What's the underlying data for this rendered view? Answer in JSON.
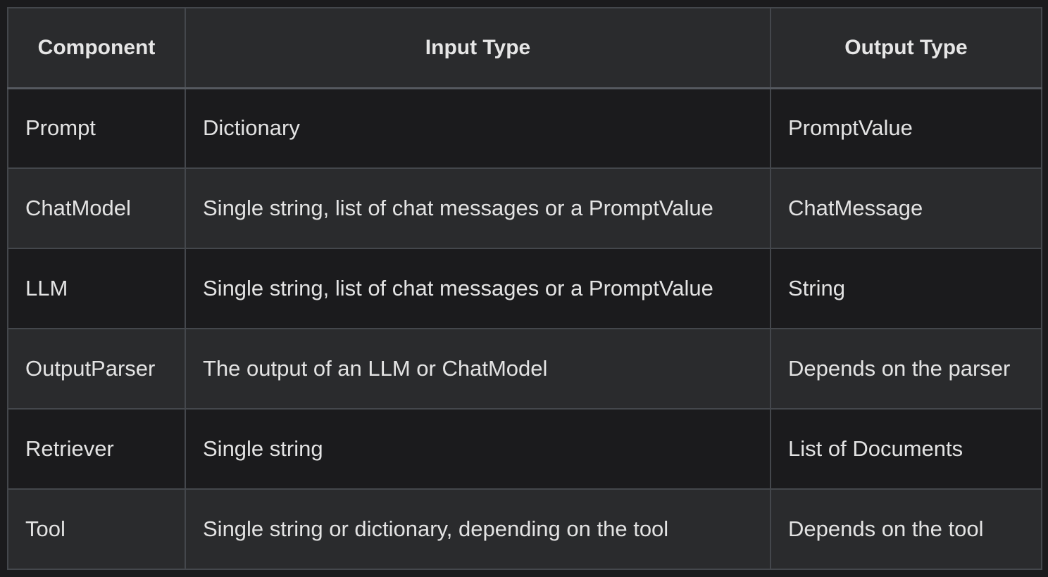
{
  "table": {
    "headers": [
      "Component",
      "Input Type",
      "Output Type"
    ],
    "rows": [
      [
        "Prompt",
        "Dictionary",
        "PromptValue"
      ],
      [
        "ChatModel",
        "Single string, list of chat messages or a PromptValue",
        "ChatMessage"
      ],
      [
        "LLM",
        "Single string, list of chat messages or a PromptValue",
        "String"
      ],
      [
        "OutputParser",
        "The output of an LLM or ChatModel",
        "Depends on the parser"
      ],
      [
        "Retriever",
        "Single string",
        "List of Documents"
      ],
      [
        "Tool",
        "Single string or dictionary, depending on the tool",
        "Depends on the tool"
      ]
    ]
  },
  "colors": {
    "background": "#1b1b1d",
    "row_alt": "#2a2b2d",
    "border": "#44474c",
    "text": "#e3e3e3"
  }
}
